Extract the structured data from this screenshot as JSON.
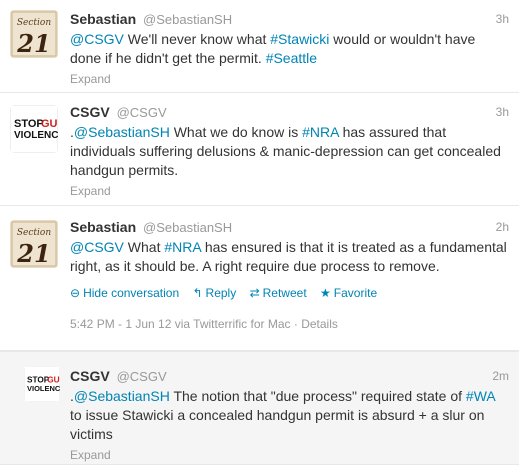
{
  "tweets": [
    {
      "fullname": "Sebastian",
      "username": "@SebastianSH",
      "time": "3h",
      "text": [
        "@CSGV",
        " We'll never know what ",
        "#Stawicki",
        " would or wouldn't have done if he didn't get the permit. ",
        "#Seattle"
      ],
      "expand": "Expand",
      "avatar_text": "21",
      "avatar_sub": "Section"
    },
    {
      "fullname": "CSGV",
      "username": "@CSGV",
      "time": "3h",
      "text": [
        ".",
        "@SebastianSH",
        " What we do know is ",
        "#NRA",
        " has assured that individuals suffering delusions & manic-depression can get concealed handgun permits."
      ],
      "expand": "Expand",
      "avatar_line1a": "STOP",
      "avatar_line1b": "GUN",
      "avatar_line2": "VIOLENCE"
    },
    {
      "fullname": "Sebastian",
      "username": "@SebastianSH",
      "time": "2h",
      "text": [
        "@CSGV",
        " What ",
        "#NRA",
        " has ensured is that it is treated as a fundamental right, as it should be. A right require due process to remove."
      ],
      "actions": {
        "hide": "Hide conversation",
        "reply": "Reply",
        "retweet": "Retweet",
        "favorite": "Favorite"
      },
      "meta": {
        "timestamp": "5:42 PM - 1 Jun 12 via Twitterrific for Mac",
        "sep": " · ",
        "details": "Details"
      },
      "avatar_text": "21",
      "avatar_sub": "Section"
    },
    {
      "fullname": "CSGV",
      "username": "@CSGV",
      "time": "2m",
      "text": [
        ".",
        "@SebastianSH",
        " The notion that \"due process\" required state of ",
        "#WA",
        " to issue Stawicki a concealed handgun permit is absurd + a slur on victims"
      ],
      "expand": "Expand",
      "avatar_line1a": "STOP",
      "avatar_line1b": "GUN",
      "avatar_line2": "VIOLENCE"
    }
  ],
  "colors": {
    "link": "#0084b4",
    "muted": "#999999",
    "text": "#333333",
    "stop_red": "#cc1f1f"
  }
}
